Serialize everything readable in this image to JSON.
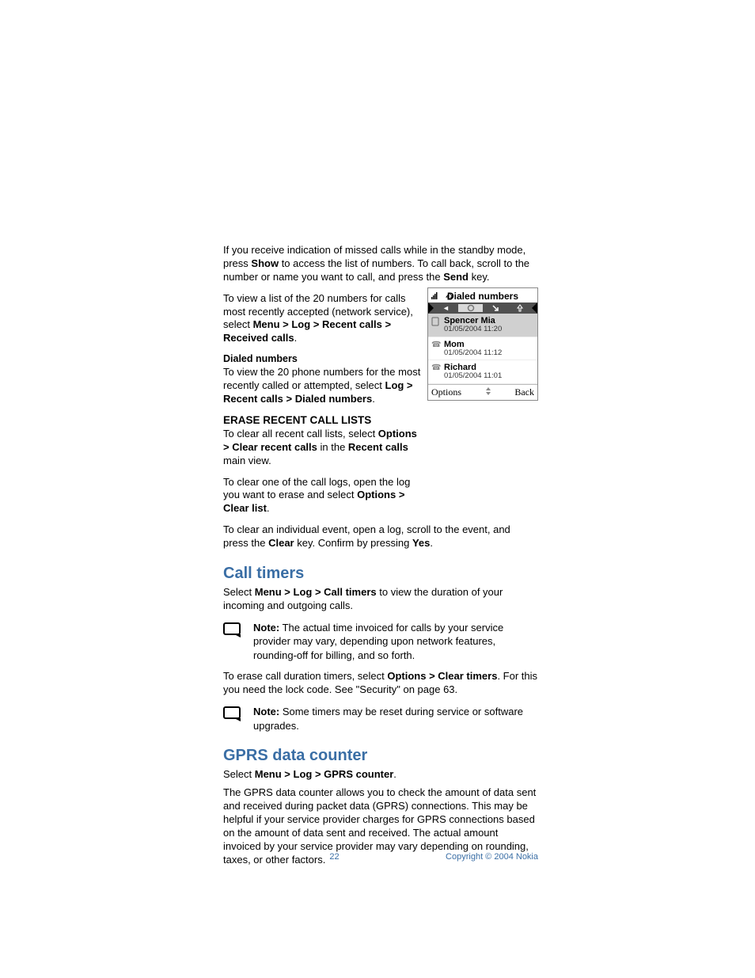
{
  "para1": {
    "t1": "If you receive indication of missed calls while in the standby mode, press ",
    "b1": "Show",
    "t2": " to access the list of numbers. To call back, scroll to the number or name you want to call, and press the ",
    "b2": "Send",
    "t3": " key."
  },
  "para2": {
    "t1": "To view a list of the 20 numbers for calls most recently accepted (network service), select ",
    "b1": "Menu > Log > Recent calls > Received calls",
    "t2": "."
  },
  "sub_dialed": "Dialed numbers",
  "para3": {
    "t1": "To view the 20 phone numbers for the most recently called or attempted, select ",
    "b1": "Log > Recent calls > Dialed numbers",
    "t2": "."
  },
  "caps_erase": "ERASE RECENT CALL LISTS",
  "para4": {
    "t1": "To clear all recent call lists, select ",
    "b1": "Options > Clear recent calls",
    "t2": " in the ",
    "b2": "Recent calls",
    "t3": " main view."
  },
  "para5": {
    "t1": "To clear one of the call logs, open the log you want to erase and select ",
    "b1": "Options > Clear list",
    "t2": "."
  },
  "para6": {
    "t1": "To clear an individual event, open a log, scroll to the event, and press the ",
    "b1": "Clear",
    "t2": " key. Confirm by pressing ",
    "b2": "Yes",
    "t3": "."
  },
  "h_call_timers": "Call timers",
  "para7": {
    "t1": "Select ",
    "b1": "Menu > Log > Call timers",
    "t2": " to view the duration of your incoming and outgoing calls."
  },
  "note1": {
    "b": "Note:",
    "t": " The actual time invoiced for calls by your service provider may vary, depending upon network features, rounding-off for billing, and so forth."
  },
  "para8": {
    "t1": "To erase call duration timers, select ",
    "b1": "Options > Clear timers",
    "t2": ". For this you need the lock code. See \"Security\" on page 63."
  },
  "note2": {
    "b": "Note:",
    "t": " Some timers may be reset during service or software upgrades."
  },
  "h_gprs": "GPRS data counter",
  "para9": {
    "t1": "Select ",
    "b1": "Menu > Log > GPRS counter",
    "t2": "."
  },
  "para10": "The GPRS data counter allows you to check the amount of data sent and received during packet data (GPRS) connections. This may be helpful if your service provider charges for GPRS connections based on the amount of data sent and received. The actual amount invoiced by your service provider may vary depending on rounding, taxes, or other factors.",
  "footer": {
    "page": "22",
    "copyright": "Copyright © 2004 Nokia"
  },
  "phone": {
    "title": "Dialed numbers",
    "items": [
      {
        "name": "Spencer Mia",
        "date": "01/05/2004 11:20"
      },
      {
        "name": "Mom",
        "date": "01/05/2004 11:12"
      },
      {
        "name": "Richard",
        "date": "01/05/2004 11:01"
      }
    ],
    "soft_left": "Options",
    "soft_right": "Back"
  }
}
